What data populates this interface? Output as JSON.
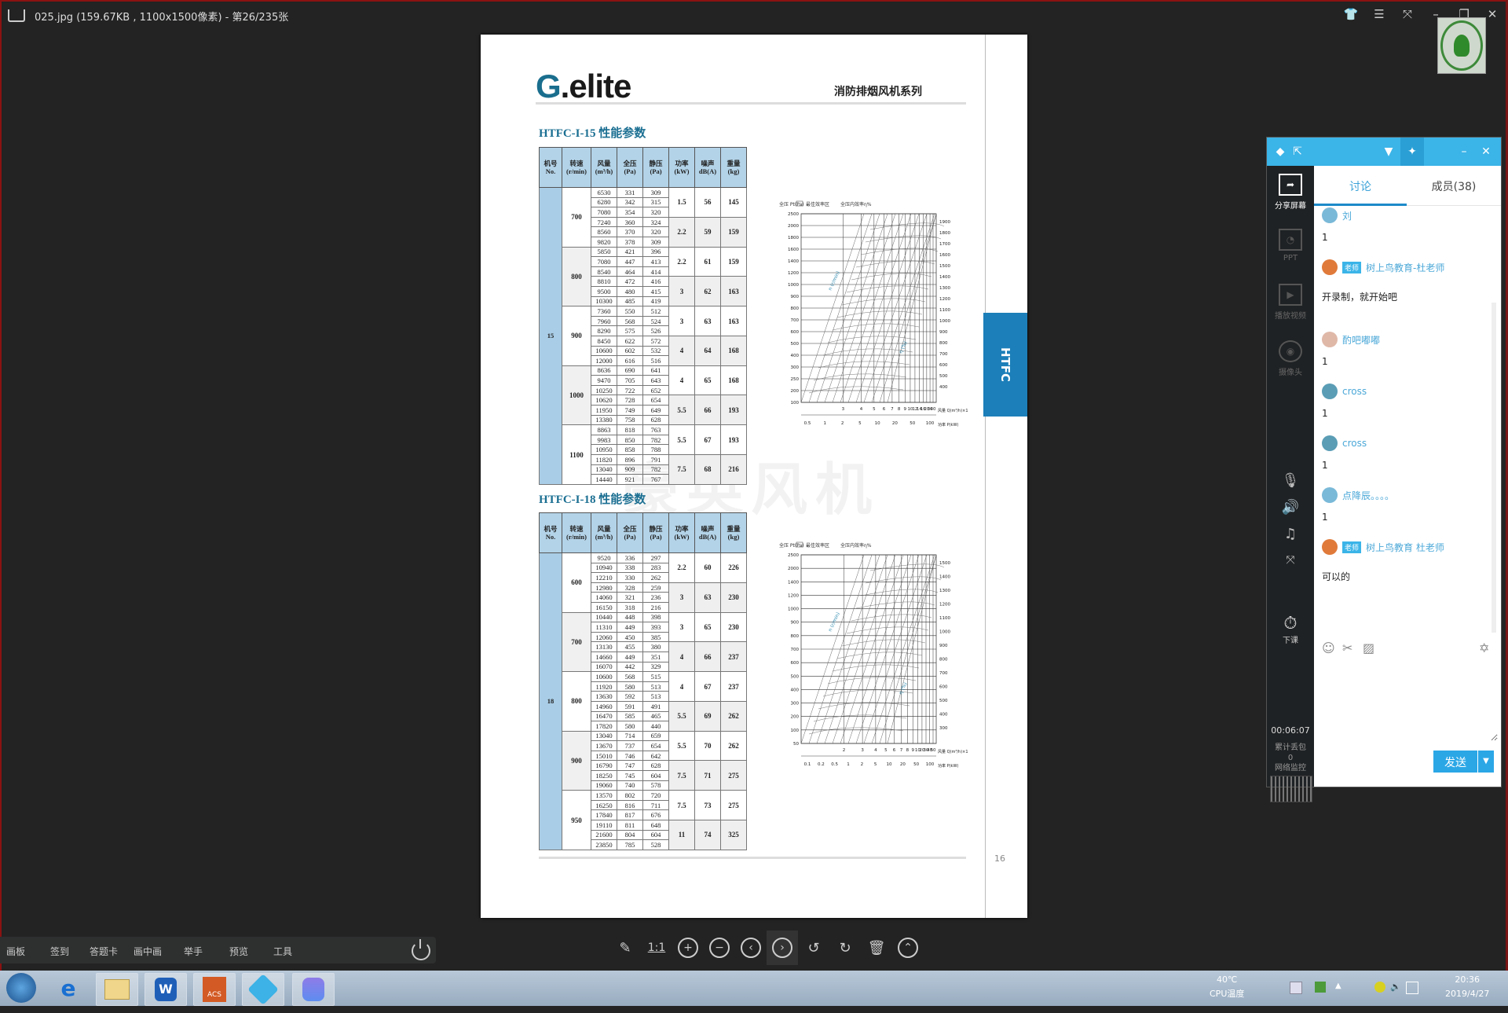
{
  "window": {
    "title": "025.jpg (159.67KB , 1100x1500像素) - 第26/235张",
    "controls": [
      "skin-icon",
      "menu-icon",
      "fullscreen-icon",
      "minimize-icon",
      "restore-icon",
      "close-icon"
    ]
  },
  "document": {
    "logo": "G.elite",
    "logo_g": "G",
    "logo_rest": ".elite",
    "series": "消防排烟风机系列",
    "side_tab": "HTFC",
    "page_number": "16",
    "watermark": "豪英风机",
    "table_headers": [
      "机号\nNo.",
      "转速\n(r/min)",
      "风量\n(m³/h)",
      "全压\n(Pa)",
      "静压\n(Pa)",
      "功率\n(kW)",
      "噪声\ndB(A)",
      "重量\n(kg)"
    ],
    "tables": [
      {
        "title": "HTFC-I-15 性能参数",
        "machine_no": "15",
        "groups": [
          {
            "speed": "700",
            "rows": [
              [
                "6530",
                "331",
                "309"
              ],
              [
                "6280",
                "342",
                "315"
              ],
              [
                "7080",
                "354",
                "320"
              ],
              [
                "7240",
                "360",
                "324"
              ],
              [
                "8560",
                "370",
                "320"
              ],
              [
                "9820",
                "378",
                "309"
              ]
            ],
            "motor": [
              {
                "power": "1.5",
                "noise": "56",
                "weight": "145"
              },
              {
                "power": "2.2",
                "noise": "59",
                "weight": "159"
              }
            ]
          },
          {
            "speed": "800",
            "rows": [
              [
                "5850",
                "421",
                "396"
              ],
              [
                "7080",
                "447",
                "413"
              ],
              [
                "8540",
                "464",
                "414"
              ],
              [
                "8810",
                "472",
                "416"
              ],
              [
                "9500",
                "480",
                "415"
              ],
              [
                "10300",
                "485",
                "419"
              ]
            ],
            "motor": [
              {
                "power": "2.2",
                "noise": "61",
                "weight": "159"
              },
              {
                "power": "3",
                "noise": "62",
                "weight": "163"
              }
            ]
          },
          {
            "speed": "900",
            "rows": [
              [
                "7360",
                "550",
                "512"
              ],
              [
                "7960",
                "568",
                "524"
              ],
              [
                "8290",
                "575",
                "526"
              ],
              [
                "8450",
                "622",
                "572"
              ],
              [
                "10600",
                "602",
                "532"
              ],
              [
                "12000",
                "616",
                "516"
              ]
            ],
            "motor": [
              {
                "power": "3",
                "noise": "63",
                "weight": "163"
              },
              {
                "power": "4",
                "noise": "64",
                "weight": "168"
              }
            ]
          },
          {
            "speed": "1000",
            "rows": [
              [
                "8636",
                "690",
                "641"
              ],
              [
                "9470",
                "705",
                "643"
              ],
              [
                "10250",
                "722",
                "652"
              ],
              [
                "10620",
                "728",
                "654"
              ],
              [
                "11950",
                "749",
                "649"
              ],
              [
                "13380",
                "758",
                "628"
              ]
            ],
            "motor": [
              {
                "power": "4",
                "noise": "65",
                "weight": "168"
              },
              {
                "power": "5.5",
                "noise": "66",
                "weight": "193"
              }
            ]
          },
          {
            "speed": "1100",
            "rows": [
              [
                "8863",
                "818",
                "763"
              ],
              [
                "9983",
                "850",
                "782"
              ],
              [
                "10950",
                "858",
                "788"
              ],
              [
                "11820",
                "896",
                "791"
              ],
              [
                "13040",
                "909",
                "782"
              ],
              [
                "14440",
                "921",
                "767"
              ]
            ],
            "motor": [
              {
                "power": "5.5",
                "noise": "67",
                "weight": "193"
              },
              {
                "power": "7.5",
                "noise": "68",
                "weight": "216"
              }
            ]
          }
        ]
      },
      {
        "title": "HTFC-I-18 性能参数",
        "machine_no": "18",
        "groups": [
          {
            "speed": "600",
            "rows": [
              [
                "9520",
                "336",
                "297"
              ],
              [
                "10940",
                "338",
                "283"
              ],
              [
                "12210",
                "330",
                "262"
              ],
              [
                "12980",
                "328",
                "259"
              ],
              [
                "14060",
                "321",
                "236"
              ],
              [
                "16150",
                "318",
                "216"
              ]
            ],
            "motor": [
              {
                "power": "2.2",
                "noise": "60",
                "weight": "226"
              },
              {
                "power": "3",
                "noise": "63",
                "weight": "230"
              }
            ]
          },
          {
            "speed": "700",
            "rows": [
              [
                "10440",
                "448",
                "398"
              ],
              [
                "11310",
                "449",
                "393"
              ],
              [
                "12060",
                "450",
                "385"
              ],
              [
                "13130",
                "455",
                "380"
              ],
              [
                "14660",
                "449",
                "351"
              ],
              [
                "16070",
                "442",
                "329"
              ]
            ],
            "motor": [
              {
                "power": "3",
                "noise": "65",
                "weight": "230"
              },
              {
                "power": "4",
                "noise": "66",
                "weight": "237"
              }
            ]
          },
          {
            "speed": "800",
            "rows": [
              [
                "10600",
                "568",
                "515"
              ],
              [
                "11920",
                "580",
                "513"
              ],
              [
                "13630",
                "592",
                "513"
              ],
              [
                "14960",
                "591",
                "491"
              ],
              [
                "16470",
                "585",
                "465"
              ],
              [
                "17820",
                "580",
                "440"
              ]
            ],
            "motor": [
              {
                "power": "4",
                "noise": "67",
                "weight": "237"
              },
              {
                "power": "5.5",
                "noise": "69",
                "weight": "262"
              }
            ]
          },
          {
            "speed": "900",
            "rows": [
              [
                "13040",
                "714",
                "659"
              ],
              [
                "13670",
                "737",
                "654"
              ],
              [
                "15010",
                "746",
                "642"
              ],
              [
                "16790",
                "747",
                "628"
              ],
              [
                "18250",
                "745",
                "604"
              ],
              [
                "19060",
                "740",
                "578"
              ]
            ],
            "motor": [
              {
                "power": "5.5",
                "noise": "70",
                "weight": "262"
              },
              {
                "power": "7.5",
                "noise": "71",
                "weight": "275"
              }
            ]
          },
          {
            "speed": "950",
            "rows": [
              [
                "13570",
                "802",
                "720"
              ],
              [
                "16250",
                "816",
                "711"
              ],
              [
                "17840",
                "817",
                "676"
              ],
              [
                "19110",
                "811",
                "648"
              ],
              [
                "21600",
                "804",
                "604"
              ],
              [
                "23850",
                "785",
                "528"
              ]
            ],
            "motor": [
              {
                "power": "7.5",
                "noise": "73",
                "weight": "275"
              },
              {
                "power": "11",
                "noise": "74",
                "weight": "325"
              }
            ]
          }
        ]
      }
    ],
    "charts": [
      {
        "legend_box": "最佳效率区",
        "legend_eff": "全压内效率η%",
        "ylabel": "全压 Pt(Pa)",
        "left_ticks": [
          "100",
          "200",
          "250",
          "300",
          "400",
          "500",
          "600",
          "700",
          "800",
          "900",
          "1000",
          "1200",
          "1400",
          "1600",
          "1800",
          "2000",
          "2500"
        ],
        "right_ticks": [
          "400",
          "500",
          "600",
          "700",
          "800",
          "900",
          "1000",
          "1100",
          "1200",
          "1300",
          "1400",
          "1500",
          "1600",
          "1700",
          "1800",
          "1900"
        ],
        "x_ticks": [
          "3",
          "4",
          "5",
          "6",
          "7",
          "8",
          "9",
          "10",
          "12",
          "14",
          "16",
          "20",
          "30",
          "40"
        ],
        "x2_ticks": [
          "0.5",
          "1",
          "2",
          "5",
          "10",
          "20",
          "50",
          "100"
        ],
        "xlabel": "风量 Q(m³/h)×10³",
        "x2label": "功率 P(kW)"
      },
      {
        "legend_box": "最佳效率区",
        "legend_eff": "全压内效率η%",
        "ylabel": "全压 Pt(Pa)",
        "left_ticks": [
          "50",
          "100",
          "200",
          "300",
          "400",
          "500",
          "600",
          "700",
          "800",
          "900",
          "1000",
          "1200",
          "1400",
          "2000",
          "2500"
        ],
        "right_ticks": [
          "300",
          "400",
          "500",
          "600",
          "700",
          "800",
          "900",
          "1000",
          "1100",
          "1200",
          "1300",
          "1400",
          "1500"
        ],
        "x_ticks": [
          "2",
          "3",
          "4",
          "5",
          "6",
          "7",
          "8",
          "9",
          "10",
          "20",
          "30",
          "40",
          "50"
        ],
        "x2_ticks": [
          "0.1",
          "0.2",
          "0.5",
          "1",
          "2",
          "5",
          "10",
          "20",
          "50",
          "100"
        ],
        "xlabel": "风量 Q(m³/h)×10³",
        "x2label": "功率 P(kW)"
      }
    ]
  },
  "chat": {
    "tabs": {
      "discussion": "讨论",
      "members": "成员(38)"
    },
    "side": {
      "share_screen": "分享屏幕",
      "ppt": "PPT",
      "play_video": "播放视频",
      "camera": "摄像头",
      "end_class": "下课",
      "timer": "00:06:07",
      "packet_loss_label": "累计丢包",
      "packet_loss": "0",
      "network_label": "网络监控"
    },
    "messages": [
      {
        "name": "刘",
        "text": "1",
        "avatar": "blue",
        "badge": ""
      },
      {
        "name": "树上鸟教育-杜老师",
        "text": "开录制，就开始吧",
        "avatar": "teacher",
        "badge": "老师"
      },
      {
        "name": "酌吧嘟嘟",
        "text": "1",
        "avatar": "face",
        "badge": ""
      },
      {
        "name": "cross",
        "text": "1",
        "avatar": "wave",
        "badge": ""
      },
      {
        "name": "cross",
        "text": "1",
        "avatar": "wave",
        "badge": ""
      },
      {
        "name": "点降辰。。。。",
        "text": "1",
        "avatar": "blue",
        "badge": ""
      },
      {
        "name": "树上鸟教育 杜老师",
        "text": "可以的",
        "avatar": "teacher",
        "badge": "老师"
      }
    ],
    "input_value": "",
    "send": "发送"
  },
  "class_toolbar": {
    "items": [
      "画板",
      "签到",
      "答题卡",
      "画中画",
      "举手",
      "预览",
      "工具"
    ]
  },
  "viewer_tools": [
    "edit-icon",
    "actual-size-icon",
    "zoom-in-icon",
    "zoom-out-icon",
    "prev-icon",
    "next-icon",
    "rotate-left-icon",
    "rotate-right-icon",
    "delete-icon",
    "up-icon"
  ],
  "viewer_actual_size": "1:1",
  "taskbar": {
    "apps": [
      "start",
      "ie",
      "explorer",
      "wps",
      "acs",
      "player",
      "gallery"
    ],
    "acs_label": "ACS",
    "cpu_temp": "40℃",
    "cpu_label": "CPU温度",
    "time": "20:36",
    "date": "2019/4/27"
  }
}
